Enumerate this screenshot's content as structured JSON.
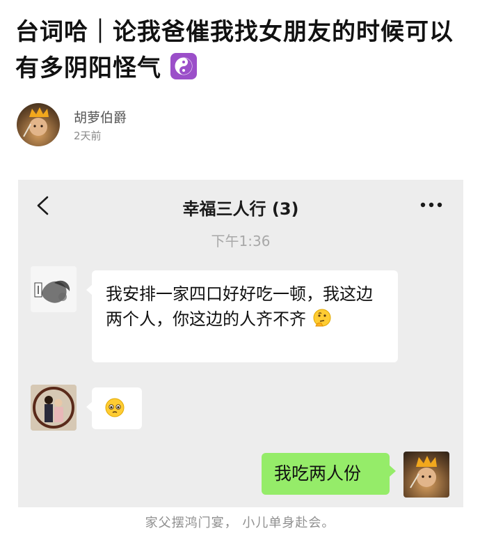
{
  "post": {
    "title": "台词哈｜论我爸催我找女朋友的时候可以有多阴阳怪气",
    "title_emoji": "yin-yang-icon",
    "author_name": "胡萝伯爵",
    "posted_time": "2天前"
  },
  "chat": {
    "title": "幸福三人行 (3)",
    "timestamp": "下午1:36",
    "messages": [
      {
        "side": "left",
        "avatar": "ink-painting-avatar",
        "text": "我安排一家四口好好吃一顿，我这边两个人，你这边的人齐不齐",
        "emoji": "thinking-face-icon"
      },
      {
        "side": "left",
        "avatar": "couple-photo-avatar",
        "text": "",
        "emoji": "pleading-face-icon"
      },
      {
        "side": "right",
        "avatar": "crown-kid-avatar",
        "text": "我吃两人份",
        "emoji": ""
      }
    ],
    "back_icon": "chevron-left-icon",
    "more_icon": "more-dots-icon"
  },
  "caption": "家父摆鸿门宴，  小儿单身赴会。",
  "colors": {
    "chat_background": "#ededed",
    "self_bubble": "#95ec69",
    "other_bubble": "#ffffff",
    "emoji_badge": "#9b4fc9"
  }
}
